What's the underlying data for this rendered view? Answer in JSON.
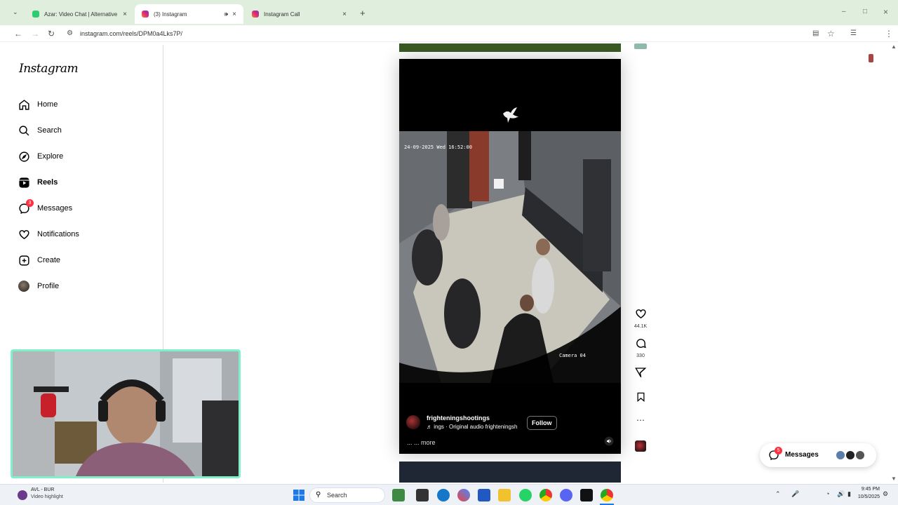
{
  "browser": {
    "tabs": [
      {
        "title": "Azar: Video Chat | Alternative t",
        "active": false
      },
      {
        "title": "(3) Instagram",
        "active": true
      },
      {
        "title": "Instagram Call",
        "active": false
      }
    ],
    "url": "instagram.com/reels/DPM0a4Lks7P/"
  },
  "sidebar": {
    "logo": "Instagram",
    "items": [
      {
        "label": "Home",
        "icon": "home-icon"
      },
      {
        "label": "Search",
        "icon": "search-icon"
      },
      {
        "label": "Explore",
        "icon": "compass-icon"
      },
      {
        "label": "Reels",
        "icon": "reels-icon"
      },
      {
        "label": "Messages",
        "icon": "messenger-icon",
        "badge": "3"
      },
      {
        "label": "Notifications",
        "icon": "heart-icon"
      },
      {
        "label": "Create",
        "icon": "plus-square-icon"
      },
      {
        "label": "Profile",
        "icon": "avatar"
      }
    ]
  },
  "reel": {
    "timestamp": "24-09-2025 Wed 16:52:00",
    "camera_label": "Camera 04",
    "author": "frighteningshootings",
    "audio": "♬ ings · Original audio  frighteningsh",
    "follow_label": "Follow",
    "caption": "... ... more",
    "likes": "44.1K",
    "comments": "330"
  },
  "messages_pill": {
    "label": "Messages",
    "badge": "5"
  },
  "taskbar": {
    "notification_title": "AVL - BUR",
    "notification_sub": "Video highlight",
    "search_label": "Search",
    "time": "9:45 PM",
    "date": "10/5/2025"
  },
  "colors": {
    "accent": "#ff3040",
    "tabbar": "#dfeedd",
    "cam_border": "#7ff0c8"
  }
}
